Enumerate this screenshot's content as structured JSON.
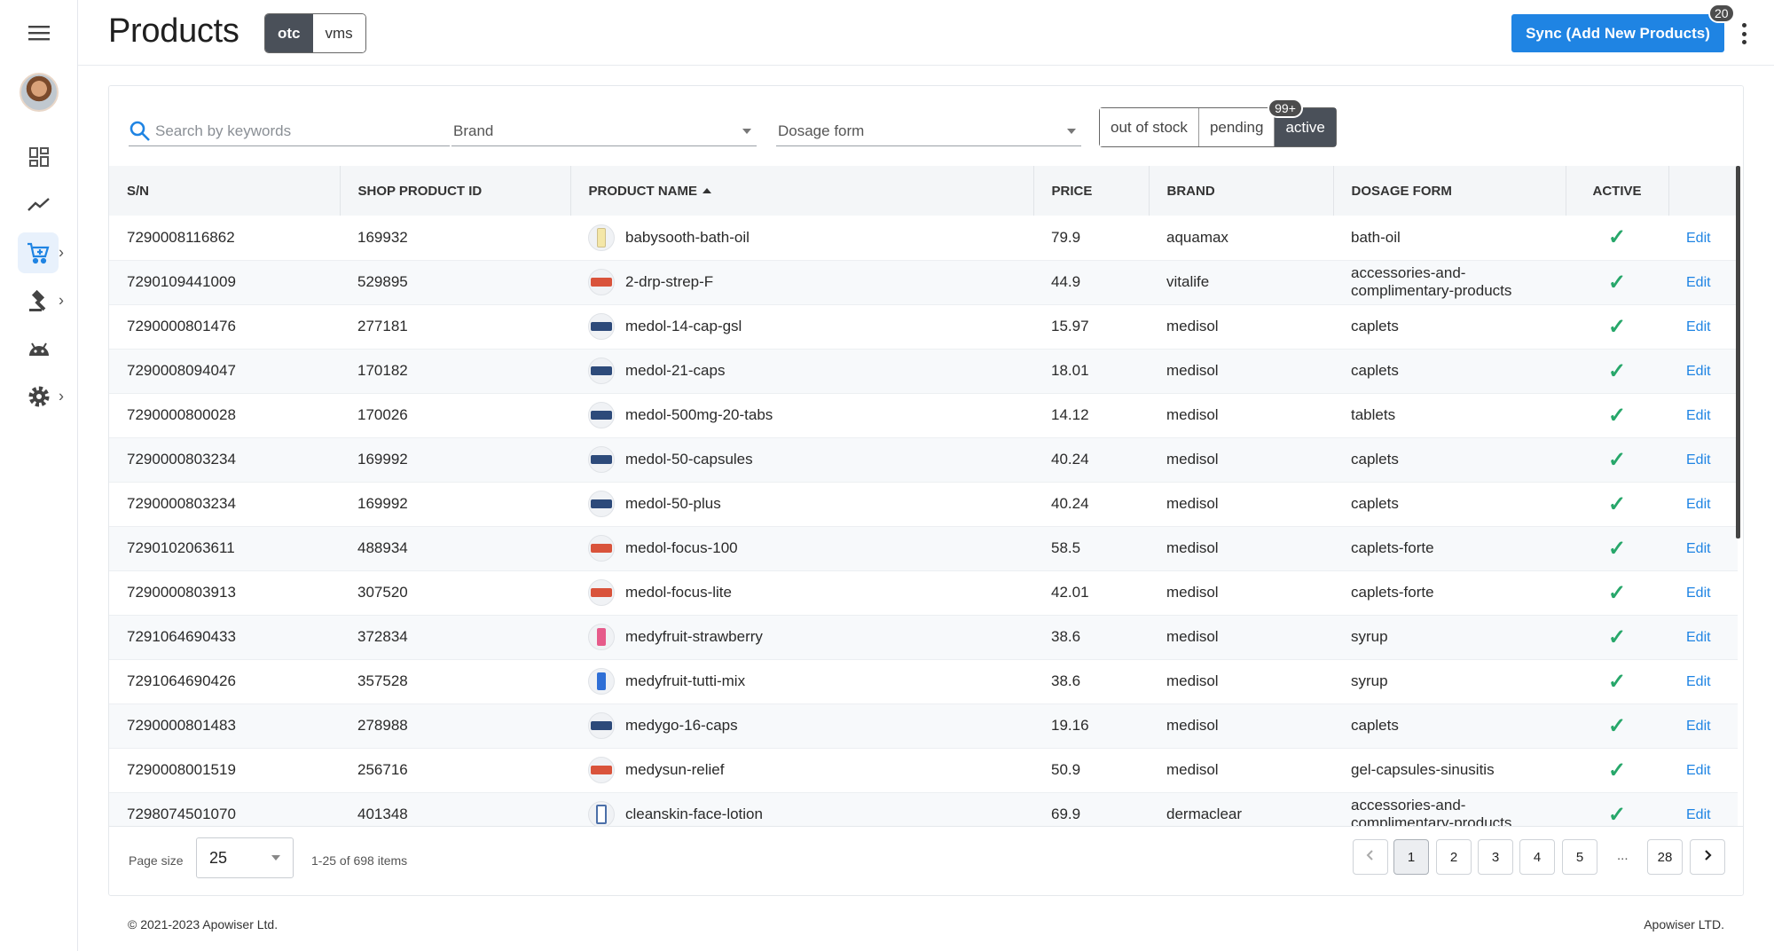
{
  "header": {
    "title": "Products",
    "segments": [
      "otc",
      "vms"
    ],
    "selected_segment": "otc",
    "sync_button": "Sync (Add New Products)",
    "sync_badge": "20"
  },
  "sidebar": {
    "items": [
      {
        "icon": "menu-icon"
      },
      {
        "icon": "avatar"
      },
      {
        "icon": "dashboard-icon"
      },
      {
        "icon": "trending-icon"
      },
      {
        "icon": "cart-icon",
        "active": true,
        "chevron": true
      },
      {
        "icon": "gavel-icon",
        "chevron": true
      },
      {
        "icon": "android-icon"
      },
      {
        "icon": "gear-icon",
        "chevron": true
      }
    ]
  },
  "filters": {
    "search_placeholder": "Search by keywords",
    "brand_placeholder": "Brand",
    "dosage_placeholder": "Dosage form",
    "status_options": [
      "out of stock",
      "pending",
      "active"
    ],
    "selected_status": "active",
    "status_badge": "99+"
  },
  "table": {
    "columns": [
      "S/N",
      "SHOP PRODUCT ID",
      "PRODUCT NAME",
      "PRICE",
      "BRAND",
      "DOSAGE FORM",
      "ACTIVE",
      ""
    ],
    "edit_label": "Edit",
    "rows": [
      {
        "sn": "7290008116862",
        "shop_id": "169932",
        "name": "babysooth-bath-oil",
        "thumb": "bottle",
        "price": "79.9",
        "brand": "aquamax",
        "dosage": "bath-oil",
        "active": "✓"
      },
      {
        "sn": "7290109441009",
        "shop_id": "529895",
        "name": "2-drp-strep-F",
        "thumb": "red",
        "price": "44.9",
        "brand": "vitalife",
        "dosage": "accessories-and-complimentary-products",
        "active": "✓"
      },
      {
        "sn": "7290000801476",
        "shop_id": "277181",
        "name": "medol-14-cap-gsl",
        "thumb": "navy",
        "price": "15.97",
        "brand": "medisol",
        "dosage": "caplets",
        "active": "✓"
      },
      {
        "sn": "7290008094047",
        "shop_id": "170182",
        "name": "medol-21-caps",
        "thumb": "navy",
        "price": "18.01",
        "brand": "medisol",
        "dosage": "caplets",
        "active": "✓"
      },
      {
        "sn": "7290000800028",
        "shop_id": "170026",
        "name": "medol-500mg-20-tabs",
        "thumb": "navy",
        "price": "14.12",
        "brand": "medisol",
        "dosage": "tablets",
        "active": "✓"
      },
      {
        "sn": "7290000803234",
        "shop_id": "169992",
        "name": "medol-50-capsules",
        "thumb": "navy",
        "price": "40.24",
        "brand": "medisol",
        "dosage": "caplets",
        "active": "✓"
      },
      {
        "sn": "7290000803234",
        "shop_id": "169992",
        "name": "medol-50-plus",
        "thumb": "navy",
        "price": "40.24",
        "brand": "medisol",
        "dosage": "caplets",
        "active": "✓"
      },
      {
        "sn": "7290102063611",
        "shop_id": "488934",
        "name": "medol-focus-100",
        "thumb": "red",
        "price": "58.5",
        "brand": "medisol",
        "dosage": "caplets-forte",
        "active": "✓"
      },
      {
        "sn": "7290000803913",
        "shop_id": "307520",
        "name": "medol-focus-lite",
        "thumb": "red",
        "price": "42.01",
        "brand": "medisol",
        "dosage": "caplets-forte",
        "active": "✓"
      },
      {
        "sn": "7291064690433",
        "shop_id": "372834",
        "name": "medyfruit-strawberry",
        "thumb": "pink",
        "price": "38.6",
        "brand": "medisol",
        "dosage": "syrup",
        "active": "✓"
      },
      {
        "sn": "7291064690426",
        "shop_id": "357528",
        "name": "medyfruit-tutti-mix",
        "thumb": "blue",
        "price": "38.6",
        "brand": "medisol",
        "dosage": "syrup",
        "active": "✓"
      },
      {
        "sn": "7290000801483",
        "shop_id": "278988",
        "name": "medygo-16-caps",
        "thumb": "navy",
        "price": "19.16",
        "brand": "medisol",
        "dosage": "caplets",
        "active": "✓"
      },
      {
        "sn": "7290008001519",
        "shop_id": "256716",
        "name": "medysun-relief",
        "thumb": "red",
        "price": "50.9",
        "brand": "medisol",
        "dosage": "gel-capsules-sinusitis",
        "active": "✓"
      },
      {
        "sn": "7298074501070",
        "shop_id": "401348",
        "name": "cleanskin-face-lotion",
        "thumb": "tube",
        "price": "69.9",
        "brand": "dermaclear",
        "dosage": "accessories-and-complimentary-products",
        "active": "✓"
      }
    ]
  },
  "pagination": {
    "page_size_label": "Page size",
    "page_size": "25",
    "items_count": "1-25 of 698 items",
    "pages": [
      "1",
      "2",
      "3",
      "4",
      "5"
    ],
    "ellipsis": "...",
    "last_page": "28",
    "current_page": "1"
  },
  "footer": {
    "copyright": "© 2021-2023 Apowiser Ltd.",
    "company": "Apowiser LTD."
  },
  "colors": {
    "accent": "#1f84e3",
    "segment_active": "#4a5059",
    "check": "#27a76a"
  }
}
